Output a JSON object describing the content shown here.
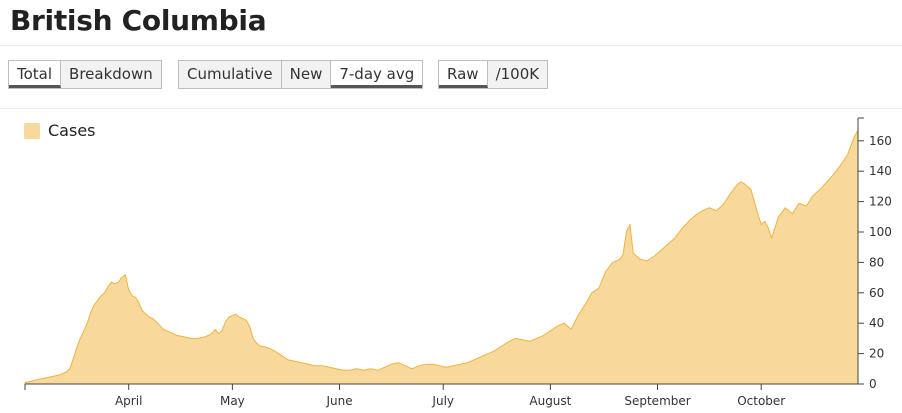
{
  "page": {
    "title": "British Columbia"
  },
  "controls": {
    "group1": [
      {
        "label": "Total",
        "active": true
      },
      {
        "label": "Breakdown",
        "active": false
      }
    ],
    "group2": [
      {
        "label": "Cumulative",
        "active": false
      },
      {
        "label": "New",
        "active": false
      },
      {
        "label": "7-day avg",
        "active": true
      }
    ],
    "group3": [
      {
        "label": "Raw",
        "active": true
      },
      {
        "label": "/100K",
        "active": false
      }
    ]
  },
  "colors": {
    "fill": "#f9d89c",
    "stroke": "#f0b33c",
    "axis": "#444444"
  },
  "chart_data": {
    "type": "area",
    "title": "",
    "xlabel": "",
    "ylabel": "",
    "legend": {
      "position": "top-left",
      "entries": [
        "Cases"
      ]
    },
    "grid": false,
    "y_axis_position": "right",
    "xlim": [
      0,
      230
    ],
    "ylim": [
      0,
      175
    ],
    "x_ticks": [
      {
        "label": "April",
        "x": 30
      },
      {
        "label": "May",
        "x": 60
      },
      {
        "label": "June",
        "x": 91
      },
      {
        "label": "July",
        "x": 121
      },
      {
        "label": "August",
        "x": 152
      },
      {
        "label": "September",
        "x": 183
      },
      {
        "label": "October",
        "x": 213
      }
    ],
    "y_ticks": [
      0,
      20,
      40,
      60,
      80,
      100,
      120,
      140,
      160
    ],
    "series": [
      {
        "name": "Cases",
        "points": [
          [
            0,
            1
          ],
          [
            2,
            2
          ],
          [
            4,
            3
          ],
          [
            6,
            4
          ],
          [
            8,
            5
          ],
          [
            10,
            6
          ],
          [
            12,
            8
          ],
          [
            13,
            10
          ],
          [
            14,
            17
          ],
          [
            15,
            24
          ],
          [
            16,
            30
          ],
          [
            17,
            35
          ],
          [
            18,
            40
          ],
          [
            19,
            47
          ],
          [
            20,
            52
          ],
          [
            21,
            55
          ],
          [
            22,
            58
          ],
          [
            23,
            60
          ],
          [
            24,
            64
          ],
          [
            25,
            67
          ],
          [
            26,
            66
          ],
          [
            27,
            67
          ],
          [
            28,
            70
          ],
          [
            29,
            72
          ],
          [
            30,
            62
          ],
          [
            31,
            58
          ],
          [
            32,
            57
          ],
          [
            33,
            53
          ],
          [
            34,
            48
          ],
          [
            35,
            46
          ],
          [
            36,
            44
          ],
          [
            37,
            43
          ],
          [
            38,
            41
          ],
          [
            40,
            36
          ],
          [
            42,
            34
          ],
          [
            44,
            32
          ],
          [
            46,
            31
          ],
          [
            48,
            30
          ],
          [
            50,
            30
          ],
          [
            52,
            31
          ],
          [
            54,
            33
          ],
          [
            55,
            36
          ],
          [
            56,
            33
          ],
          [
            57,
            35
          ],
          [
            58,
            41
          ],
          [
            59,
            44
          ],
          [
            60,
            45
          ],
          [
            61,
            46
          ],
          [
            62,
            44
          ],
          [
            63,
            43
          ],
          [
            64,
            42
          ],
          [
            65,
            38
          ],
          [
            66,
            30
          ],
          [
            67,
            27
          ],
          [
            68,
            25
          ],
          [
            70,
            24
          ],
          [
            72,
            22
          ],
          [
            74,
            19
          ],
          [
            76,
            16
          ],
          [
            78,
            15
          ],
          [
            80,
            14
          ],
          [
            82,
            13
          ],
          [
            84,
            12
          ],
          [
            86,
            12
          ],
          [
            88,
            11
          ],
          [
            90,
            10
          ],
          [
            92,
            9
          ],
          [
            94,
            9
          ],
          [
            96,
            10
          ],
          [
            98,
            9
          ],
          [
            100,
            10
          ],
          [
            102,
            9
          ],
          [
            104,
            11
          ],
          [
            106,
            13
          ],
          [
            108,
            14
          ],
          [
            110,
            12
          ],
          [
            112,
            10
          ],
          [
            114,
            12
          ],
          [
            116,
            13
          ],
          [
            118,
            13
          ],
          [
            120,
            12
          ],
          [
            122,
            11
          ],
          [
            124,
            12
          ],
          [
            126,
            13
          ],
          [
            128,
            14
          ],
          [
            130,
            16
          ],
          [
            132,
            18
          ],
          [
            134,
            20
          ],
          [
            136,
            22
          ],
          [
            138,
            25
          ],
          [
            140,
            28
          ],
          [
            142,
            30
          ],
          [
            144,
            29
          ],
          [
            146,
            28
          ],
          [
            148,
            30
          ],
          [
            150,
            32
          ],
          [
            152,
            35
          ],
          [
            154,
            38
          ],
          [
            156,
            40
          ],
          [
            158,
            36
          ],
          [
            160,
            45
          ],
          [
            162,
            52
          ],
          [
            164,
            60
          ],
          [
            166,
            63
          ],
          [
            168,
            74
          ],
          [
            170,
            80
          ],
          [
            172,
            82
          ],
          [
            173,
            85
          ],
          [
            174,
            100
          ],
          [
            175,
            105
          ],
          [
            176,
            86
          ],
          [
            178,
            82
          ],
          [
            180,
            81
          ],
          [
            182,
            84
          ],
          [
            184,
            88
          ],
          [
            186,
            92
          ],
          [
            188,
            96
          ],
          [
            190,
            102
          ],
          [
            192,
            107
          ],
          [
            194,
            111
          ],
          [
            196,
            114
          ],
          [
            198,
            116
          ],
          [
            200,
            114
          ],
          [
            202,
            118
          ],
          [
            204,
            125
          ],
          [
            206,
            131
          ],
          [
            207,
            133
          ],
          [
            208,
            132
          ],
          [
            210,
            128
          ],
          [
            212,
            112
          ],
          [
            213,
            105
          ],
          [
            214,
            107
          ],
          [
            215,
            103
          ],
          [
            216,
            96
          ],
          [
            217,
            103
          ],
          [
            218,
            110
          ],
          [
            220,
            116
          ],
          [
            222,
            112
          ],
          [
            224,
            119
          ],
          [
            226,
            117
          ],
          [
            228,
            124
          ],
          [
            230,
            128
          ],
          [
            232,
            133
          ],
          [
            234,
            138
          ],
          [
            236,
            144
          ],
          [
            238,
            151
          ],
          [
            240,
            163
          ],
          [
            241,
            167
          ]
        ]
      }
    ]
  }
}
